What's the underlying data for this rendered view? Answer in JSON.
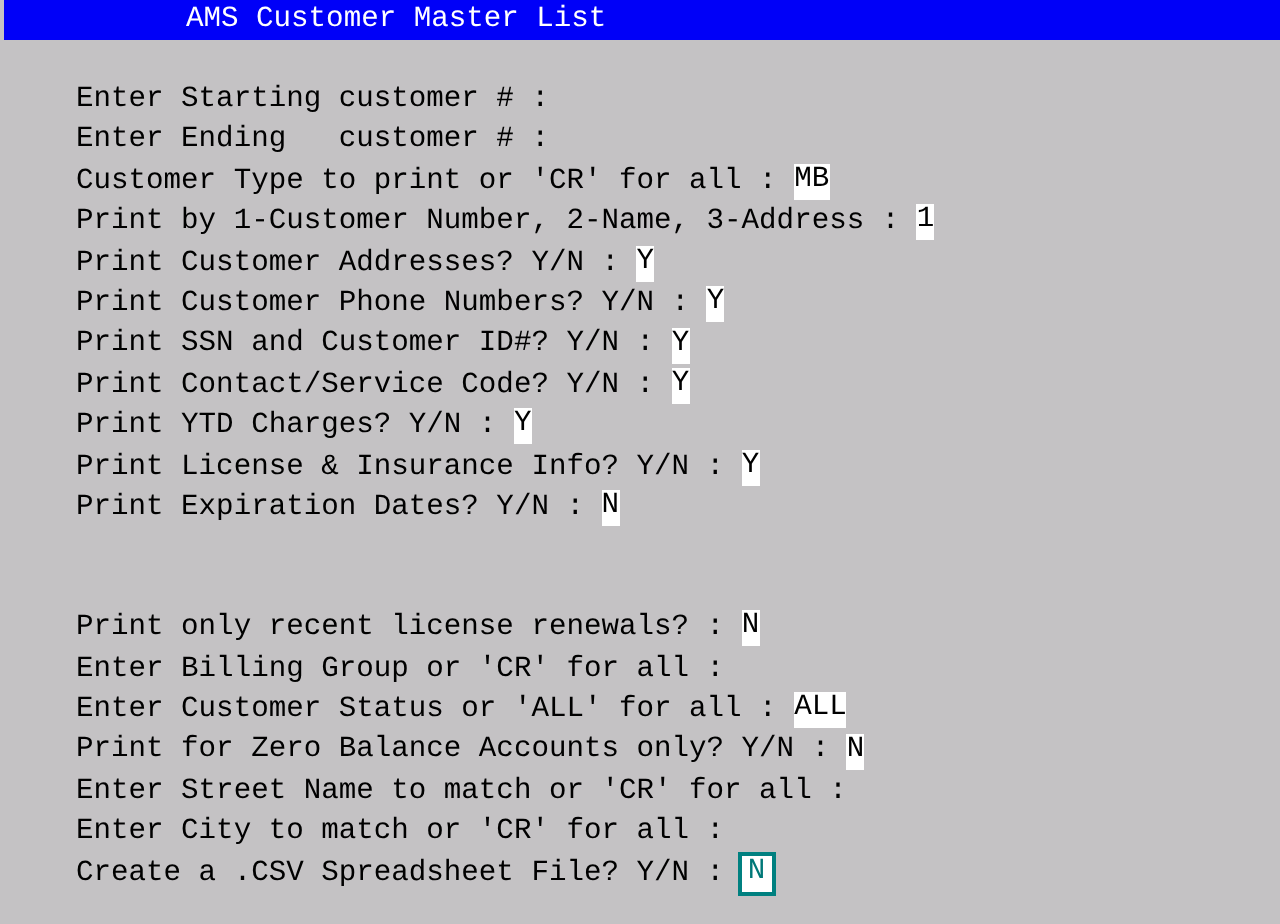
{
  "title": "AMS Customer Master List",
  "groups": [
    [
      {
        "prompt": "Enter Starting customer # :"
      },
      {
        "prompt": "Enter Ending   customer # :"
      },
      {
        "prompt": "Customer Type to print or 'CR' for all :",
        "value": "MB"
      },
      {
        "prompt": "Print by 1-Customer Number, 2-Name, 3-Address :",
        "value": "1"
      },
      {
        "prompt": "Print Customer Addresses? Y/N :",
        "value": "Y"
      },
      {
        "prompt": "Print Customer Phone Numbers? Y/N :",
        "value": "Y"
      },
      {
        "prompt": "Print SSN and Customer ID#? Y/N :",
        "value": "Y"
      },
      {
        "prompt": "Print Contact/Service Code? Y/N :",
        "value": "Y"
      },
      {
        "prompt": "Print YTD Charges? Y/N :",
        "value": "Y"
      },
      {
        "prompt": "Print License & Insurance Info? Y/N :",
        "value": "Y"
      },
      {
        "prompt": "Print Expiration Dates? Y/N :",
        "value": "N"
      }
    ],
    [
      {
        "prompt": "Print only recent license renewals? :",
        "value": "N"
      },
      {
        "prompt": "Enter Billing Group or 'CR' for all :"
      },
      {
        "prompt": "Enter Customer Status or 'ALL' for all :",
        "value": "ALL"
      },
      {
        "prompt": "Print for Zero Balance Accounts only? Y/N :",
        "value": "N"
      },
      {
        "prompt": "Enter Street Name to match or 'CR' for all :"
      },
      {
        "prompt": "Enter City to match or 'CR' for all :"
      },
      {
        "prompt": "Create a .CSV Spreadsheet File? Y/N :",
        "value": "N",
        "focused": true
      }
    ]
  ]
}
